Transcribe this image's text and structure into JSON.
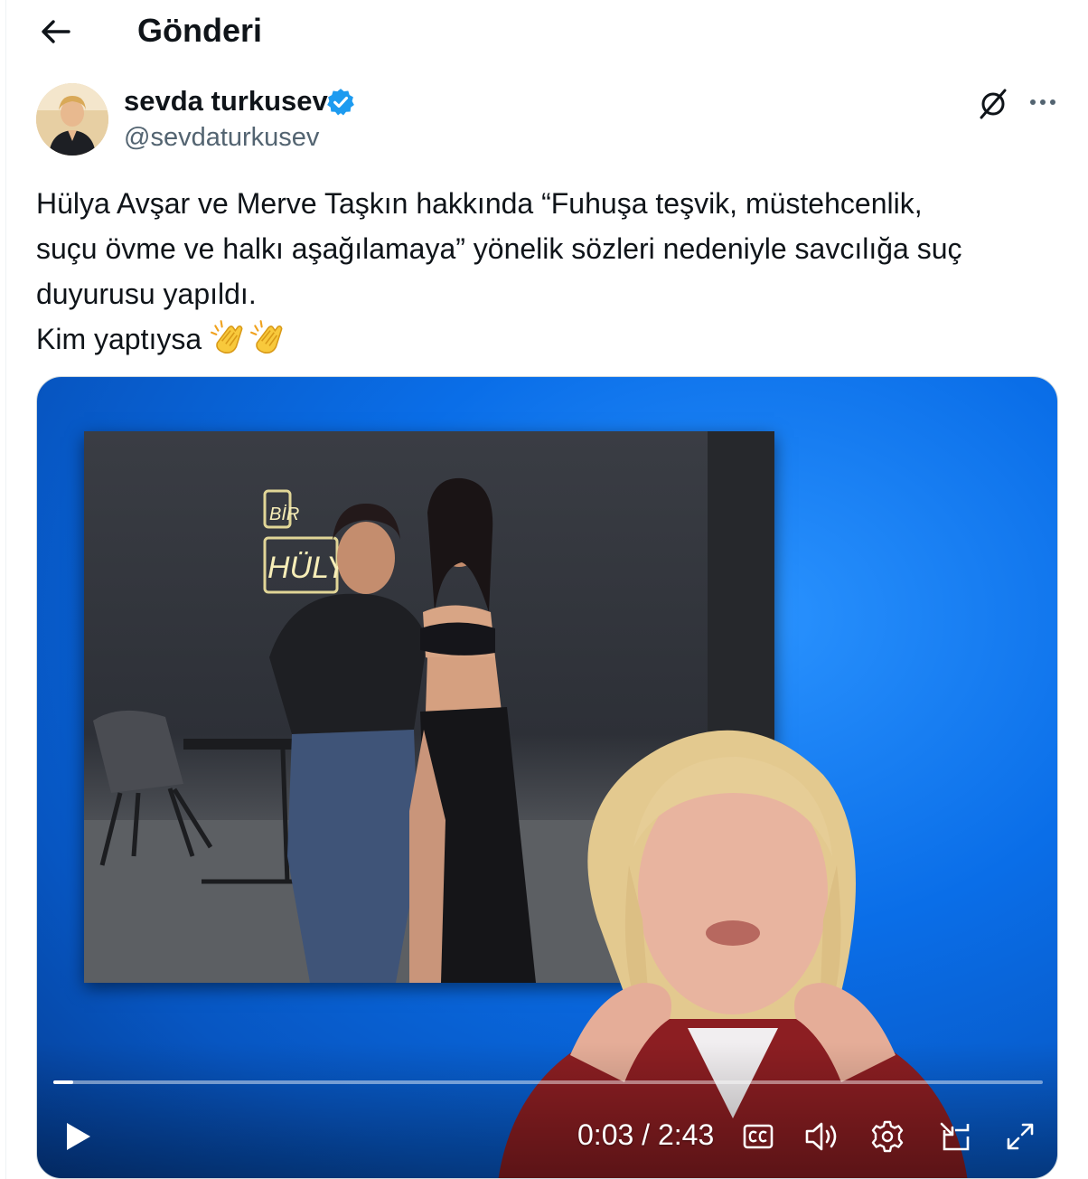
{
  "header": {
    "title": "Gönderi",
    "back_icon": "arrow-left-icon"
  },
  "author": {
    "display_name": "sevda turkusev",
    "handle": "@sevdaturkusev",
    "verified": true,
    "verified_color": "#1d9bf0"
  },
  "tweet": {
    "lines": [
      "Hülya Avşar ve Merve Taşkın hakkında “Fuhuşa teşvik, müstehcenlik,",
      "suçu övme ve halkı aşağılamaya” yönelik sözleri nedeniyle savcılığa suç",
      "duyurusu yapıldı."
    ],
    "last_line_text": "Kim  yaptıysa",
    "emoji": [
      "clapping-hands",
      "clapping-hands"
    ]
  },
  "video": {
    "current_time": "0:03",
    "duration": "2:43",
    "time_display": "0:03 / 2:43",
    "progress_fraction": 0.02,
    "inset_sign_text": "BİR HÜLY",
    "controls": [
      "play-icon",
      "closed-captions-icon",
      "volume-icon",
      "settings-gear-icon",
      "picture-in-picture-icon",
      "fullscreen-icon"
    ]
  },
  "colors": {
    "text_primary": "#0f1419",
    "text_secondary": "#536471",
    "media_bg": "#0a6ee8"
  }
}
